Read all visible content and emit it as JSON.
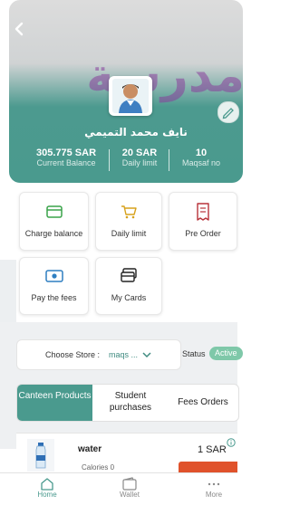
{
  "header": {
    "watermark": "مدرسة",
    "user_name": "نايف محمد التميمي",
    "stats": [
      {
        "value": "305.775 SAR",
        "label": "Current Balance"
      },
      {
        "value": "20 SAR",
        "label": "Daily limit"
      },
      {
        "value": "10",
        "label": "Maqsaf no"
      }
    ]
  },
  "actions": [
    {
      "label": "Charge balance",
      "icon": "card-icon"
    },
    {
      "label": "Daily limit",
      "icon": "cart-icon"
    },
    {
      "label": "Pre Order",
      "icon": "receipt-icon"
    },
    {
      "label": "Pay the fees",
      "icon": "cash-icon"
    },
    {
      "label": "My Cards",
      "icon": "cards-icon"
    }
  ],
  "store": {
    "label": "Choose Store :",
    "value": "maqs ...",
    "status_label": "Status",
    "status_value": "Active"
  },
  "tabs": [
    {
      "label": "Canteen Products"
    },
    {
      "label": "Student purchases"
    },
    {
      "label": "Fees Orders"
    }
  ],
  "product": {
    "name": "water",
    "price": "1 SAR",
    "calories": "Calories 0"
  },
  "bottom_nav": [
    {
      "label": "Home",
      "icon": "home-icon"
    },
    {
      "label": "Wallet",
      "icon": "wallet-icon"
    },
    {
      "label": "More",
      "icon": "more-icon"
    }
  ],
  "colors": {
    "primary": "#4a9a8e",
    "accent": "#8a3f9c",
    "danger": "#e0522b"
  }
}
